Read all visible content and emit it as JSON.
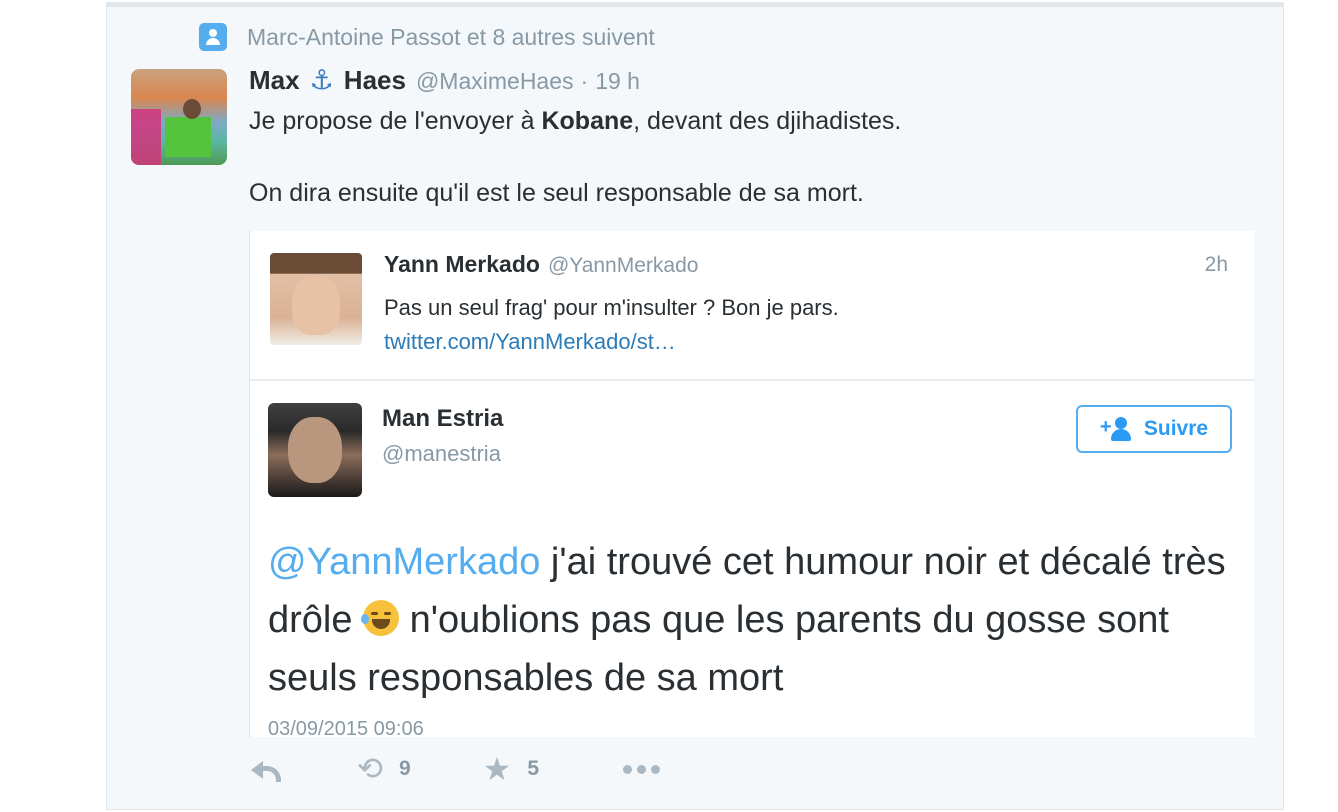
{
  "social_context": {
    "text": "Marc-Antoine Passot et 8 autres suivent",
    "icon": "person-icon"
  },
  "tweet": {
    "name_first": "Max",
    "anchor_glyph": "⚓",
    "name_last": "Haes",
    "handle": "@MaximeHaes",
    "separator": "·",
    "time": "19 h",
    "text_before": "Je propose de l'envoyer à ",
    "text_bold": "Kobane",
    "text_after": ", devant des djihadistes.",
    "text_line2": "On dira ensuite qu'il est le seul responsable de sa mort."
  },
  "quoted": {
    "name": "Yann Merkado",
    "handle": "@YannMerkado",
    "time": "2h",
    "text": "Pas un seul frag' pour m'insulter ? Bon je pars.",
    "link": "twitter.com/YannMerkado/st…"
  },
  "screenshot_tweet": {
    "name": "Man Estria",
    "handle": "@manestria",
    "follow_label": "Suivre",
    "mention": "@YannMerkado",
    "text_part1": " j'ai trouvé cet humour noir et décalé très drôle ",
    "text_part2": " n'oublions pas que les parents du gosse sont seuls responsables de sa mort",
    "date": "03/09/2015 09:06"
  },
  "actions": {
    "reply_icon": "reply-icon",
    "retweet_icon": "retweet-icon",
    "retweet_glyph": "⟲",
    "retweet_count": "9",
    "favorite_icon": "star-icon",
    "favorite_glyph": "★",
    "favorite_count": "5",
    "more_icon": "more-icon"
  },
  "colors": {
    "accent": "#55acee",
    "link": "#2b7bb9",
    "muted": "#8899a6",
    "text": "#292f33",
    "background": "#f5f8fa"
  }
}
